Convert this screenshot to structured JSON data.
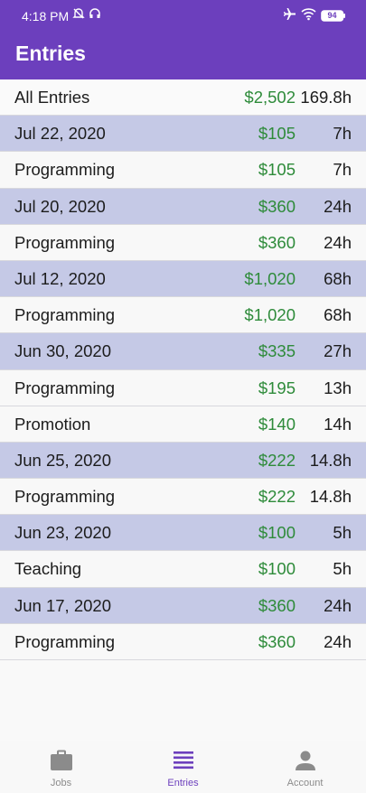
{
  "status": {
    "time": "4:18 PM",
    "battery": "94"
  },
  "appbar": {
    "title": "Entries"
  },
  "entries": [
    {
      "label": "All Entries",
      "amount": "$2,502",
      "hours": "169.8h",
      "kind": "total"
    },
    {
      "label": "Jul 22, 2020",
      "amount": "$105",
      "hours": "7h",
      "kind": "date"
    },
    {
      "label": "Programming",
      "amount": "$105",
      "hours": "7h",
      "kind": "job"
    },
    {
      "label": "Jul 20, 2020",
      "amount": "$360",
      "hours": "24h",
      "kind": "date"
    },
    {
      "label": "Programming",
      "amount": "$360",
      "hours": "24h",
      "kind": "job"
    },
    {
      "label": "Jul 12, 2020",
      "amount": "$1,020",
      "hours": "68h",
      "kind": "date"
    },
    {
      "label": "Programming",
      "amount": "$1,020",
      "hours": "68h",
      "kind": "job"
    },
    {
      "label": "Jun 30, 2020",
      "amount": "$335",
      "hours": "27h",
      "kind": "date"
    },
    {
      "label": "Programming",
      "amount": "$195",
      "hours": "13h",
      "kind": "job"
    },
    {
      "label": "Promotion",
      "amount": "$140",
      "hours": "14h",
      "kind": "job"
    },
    {
      "label": "Jun 25, 2020",
      "amount": "$222",
      "hours": "14.8h",
      "kind": "date"
    },
    {
      "label": "Programming",
      "amount": "$222",
      "hours": "14.8h",
      "kind": "job"
    },
    {
      "label": "Jun 23, 2020",
      "amount": "$100",
      "hours": "5h",
      "kind": "date"
    },
    {
      "label": "Teaching",
      "amount": "$100",
      "hours": "5h",
      "kind": "job"
    },
    {
      "label": "Jun 17, 2020",
      "amount": "$360",
      "hours": "24h",
      "kind": "date"
    },
    {
      "label": "Programming",
      "amount": "$360",
      "hours": "24h",
      "kind": "job"
    }
  ],
  "bottom_nav": {
    "items": [
      {
        "label": "Jobs",
        "icon": "briefcase-icon",
        "active": false
      },
      {
        "label": "Entries",
        "icon": "list-icon",
        "active": true
      },
      {
        "label": "Account",
        "icon": "person-icon",
        "active": false
      }
    ]
  },
  "colors": {
    "primary": "#6c3fbd",
    "date_row": "#c5c9e6",
    "amount": "#2e8b3a",
    "nav_inactive": "#8b8b8b"
  }
}
